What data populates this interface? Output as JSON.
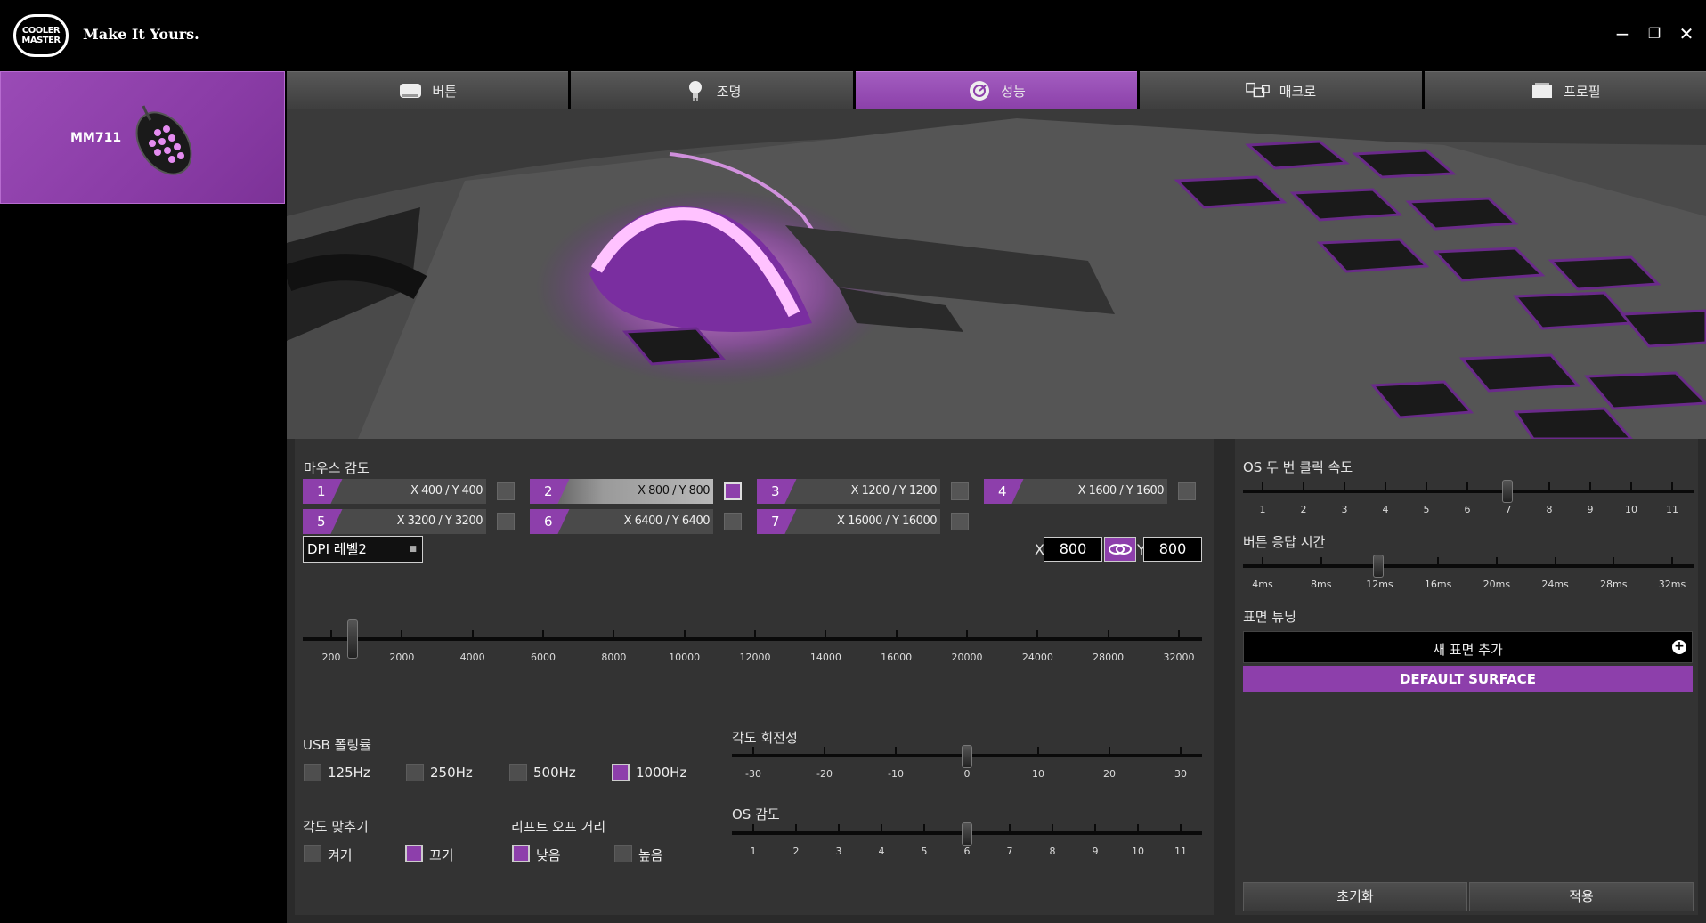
{
  "header": {
    "logo_line1": "COOLER",
    "logo_line2": "MASTER",
    "tagline": "Make It Yours.",
    "minimize": "−",
    "restore": "❐",
    "close": "✕"
  },
  "sidebar": {
    "device": "MM711"
  },
  "tabs": [
    {
      "label": "버튼",
      "icon": "button-icon"
    },
    {
      "label": "조명",
      "icon": "lighting-icon"
    },
    {
      "label": "성능",
      "icon": "performance-icon"
    },
    {
      "label": "매크로",
      "icon": "macro-icon"
    },
    {
      "label": "프로필",
      "icon": "profile-icon"
    }
  ],
  "active_tab": "성능",
  "sensitivity": {
    "title": "마우스 감도",
    "slots": [
      {
        "num": "1",
        "value": "X 400 / Y 400"
      },
      {
        "num": "2",
        "value": "X 800 / Y 800"
      },
      {
        "num": "3",
        "value": "X 1200 / Y 1200"
      },
      {
        "num": "4",
        "value": "X 1600 / Y 1600"
      },
      {
        "num": "5",
        "value": "X 3200 / Y 3200"
      },
      {
        "num": "6",
        "value": "X 6400 / Y 6400"
      },
      {
        "num": "7",
        "value": "X 16000 / Y 16000"
      }
    ],
    "selected_slot": 2,
    "dpi_level": "DPI 레벨2",
    "x_label": "X",
    "x_value": "800",
    "y_label": "Y",
    "y_value": "800",
    "scale_labels": [
      "200",
      "2000",
      "4000",
      "6000",
      "8000",
      "10000",
      "12000",
      "14000",
      "16000",
      "20000",
      "24000",
      "28000",
      "32000"
    ],
    "slider_value": 800
  },
  "usb_polling": {
    "title": "USB 폴링률",
    "options": [
      "125Hz",
      "250Hz",
      "500Hz",
      "1000Hz"
    ],
    "selected": "1000Hz"
  },
  "angle_snapping": {
    "title": "각도 맞추기",
    "options": [
      "켜기",
      "끄기"
    ],
    "selected": "끄기"
  },
  "lift_off": {
    "title": "리프트 오프 거리",
    "options": [
      "낮음",
      "높음"
    ],
    "selected": "낮음"
  },
  "angle_rotation": {
    "title": "각도 회전성",
    "labels": [
      "-30",
      "-20",
      "-10",
      "0",
      "10",
      "20",
      "30"
    ],
    "value": 0
  },
  "os_sensitivity": {
    "title": "OS 감도",
    "labels": [
      "1",
      "2",
      "3",
      "4",
      "5",
      "6",
      "7",
      "8",
      "9",
      "10",
      "11"
    ],
    "value": 6
  },
  "double_click": {
    "title": "OS 두 번 클릭 속도",
    "labels": [
      "1",
      "2",
      "3",
      "4",
      "5",
      "6",
      "7",
      "8",
      "9",
      "10",
      "11"
    ],
    "value": 7
  },
  "response_time": {
    "title": "버튼 응답 시간",
    "labels": [
      "4ms",
      "8ms",
      "12ms",
      "16ms",
      "20ms",
      "24ms",
      "28ms",
      "32ms"
    ],
    "value": "12ms"
  },
  "surface": {
    "title": "표면 튜닝",
    "add_label": "새 표면 추가",
    "add_icon": "plus-circle-icon",
    "default_label": "DEFAULT SURFACE"
  },
  "footer": {
    "reset": "초기화",
    "apply": "적용"
  },
  "colors": {
    "accent": "#8d3fab",
    "background": "#333333"
  }
}
